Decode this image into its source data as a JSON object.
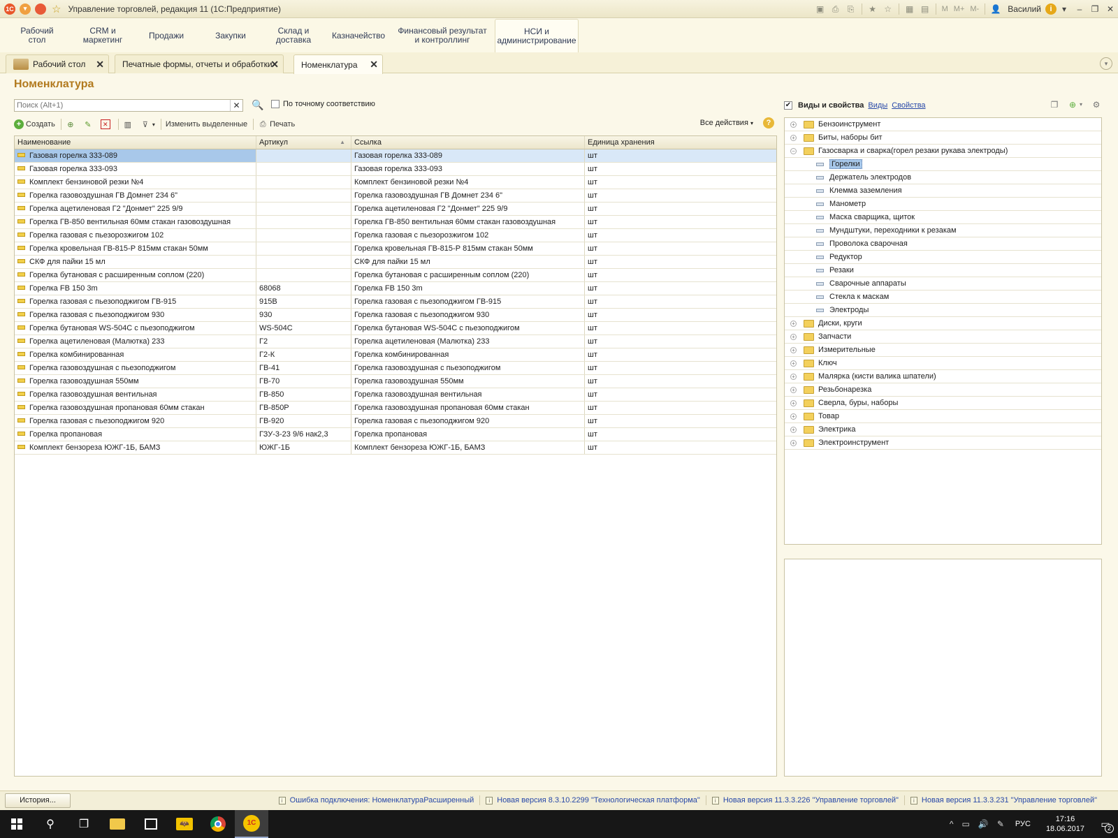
{
  "window": {
    "title": "Управление торговлей, редакция 11  (1С:Предприятие)",
    "user": "Василий",
    "m_buttons": [
      "M",
      "M+",
      "M-"
    ]
  },
  "sections": [
    {
      "label": "Рабочий\nстол"
    },
    {
      "label": "CRM и\nмаркетинг"
    },
    {
      "label": "Продажи"
    },
    {
      "label": "Закупки"
    },
    {
      "label": "Склад и\nдоставка"
    },
    {
      "label": "Казначейство"
    },
    {
      "label": "Финансовый результат\nи контроллинг"
    },
    {
      "label": "НСИ и\nадминистрирование",
      "active": true
    }
  ],
  "open_tabs": [
    {
      "label": "Рабочий стол"
    },
    {
      "label": "Печатные формы, отчеты и обработки"
    },
    {
      "label": "Номенклатура",
      "active": true
    }
  ],
  "page": {
    "title": "Номенклатура",
    "search_placeholder": "Поиск (Alt+1)",
    "exact_match_label": "По точному соответствию"
  },
  "toolbar": {
    "create": "Создать",
    "change_selected": "Изменить выделенные",
    "print": "Печать",
    "all_actions": "Все действия"
  },
  "table": {
    "columns": [
      "Наименование",
      "Артикул",
      "Ссылка",
      "Единица хранения"
    ],
    "rows": [
      [
        "Газовая горелка 333-089",
        "",
        "Газовая горелка 333-089",
        "шт"
      ],
      [
        "Газовая горелка 333-093",
        "",
        "Газовая горелка 333-093",
        "шт"
      ],
      [
        "Комплект  бензиновой резки №4",
        "",
        "Комплект  бензиновой резки №4",
        "шт"
      ],
      [
        "Горелка газовоздушная ГВ Домнет 234 6\"",
        "",
        "Горелка газовоздушная ГВ Домнет 234 6\"",
        "шт"
      ],
      [
        "Горелка ацетиленовая Г2 \"Донмет\" 225 9/9",
        "",
        "Горелка ацетиленовая Г2 \"Донмет\" 225 9/9",
        "шт"
      ],
      [
        "Горелка ГВ-850 вентильная 60мм стакан газовоздушная",
        "",
        "Горелка ГВ-850 вентильная 60мм стакан газовоздушная",
        "шт"
      ],
      [
        "Горелка газовая с пьезорозжигом 102",
        "",
        "Горелка газовая с пьезорозжигом 102",
        "шт"
      ],
      [
        "Горелка кровельная ГВ-815-Р 815мм стакан 50мм",
        "",
        "Горелка кровельная ГВ-815-Р 815мм стакан 50мм",
        "шт"
      ],
      [
        "СКФ для пайки 15 мл",
        "",
        "СКФ для пайки 15 мл",
        "шт"
      ],
      [
        "Горелка бутановая с расширенным соплом (220)",
        "",
        "Горелка бутановая с расширенным соплом (220)",
        "шт"
      ],
      [
        "Горелка FB 150 3m",
        "68068",
        "Горелка FB 150 3m",
        "шт"
      ],
      [
        "Горелка газовая с пьезоподжигом ГВ-915",
        "915В",
        "Горелка газовая с пьезоподжигом ГВ-915",
        "шт"
      ],
      [
        "Горелка газовая с пьезоподжигом 930",
        "930",
        "Горелка газовая с пьезоподжигом 930",
        "шт"
      ],
      [
        "Горелка бутановая WS-504C с пьезоподжигом",
        "WS-504C",
        "Горелка бутановая WS-504C с пьезоподжигом",
        "шт"
      ],
      [
        "Горелка ацетиленовая (Малютка) 233",
        "Г2",
        "Горелка ацетиленовая (Малютка) 233",
        "шт"
      ],
      [
        "Горелка комбинированная",
        "Г2-К",
        "Горелка комбинированная",
        "шт"
      ],
      [
        "Горелка газовоздушная с пьезоподжигом",
        "ГВ-41",
        "Горелка газовоздушная с пьезоподжигом",
        "шт"
      ],
      [
        "Горелка газовоздушная 550мм",
        "ГВ-70",
        "Горелка газовоздушная 550мм",
        "шт"
      ],
      [
        "Горелка газовоздушная вентильная",
        "ГВ-850",
        "Горелка газовоздушная вентильная",
        "шт"
      ],
      [
        "Горелка газовоздушная пропановая 60мм стакан",
        "ГВ-850Р",
        "Горелка газовоздушная пропановая 60мм стакан",
        "шт"
      ],
      [
        "Горелка газовая с пьезоподжигом 920",
        "ГВ-920",
        "Горелка газовая с пьезоподжигом 920",
        "шт"
      ],
      [
        "Горелка пропановая",
        "ГЗУ-3-23 9/6 нак2,3",
        "Горелка пропановая",
        "шт"
      ],
      [
        "Комплект  бензореза ЮЖГ-1Б, БАМЗ",
        "ЮЖГ-1Б",
        "Комплект  бензореза ЮЖГ-1Б, БАМЗ",
        "шт"
      ]
    ]
  },
  "kinds_panel": {
    "title": "Виды и свойства",
    "link_kinds": "Виды",
    "link_props": "Свойства",
    "tree": [
      {
        "label": "Бензоинструмент",
        "type": "folder",
        "tog": "+"
      },
      {
        "label": "Биты, наборы бит",
        "type": "folder",
        "tog": "+"
      },
      {
        "label": "Газосварка и сварка(горел резаки рукава электроды)",
        "type": "folder",
        "tog": "−"
      },
      {
        "label": "Горелки",
        "type": "leaf",
        "selected": true
      },
      {
        "label": "Держатель электродов",
        "type": "leaf"
      },
      {
        "label": "Клемма заземления",
        "type": "leaf"
      },
      {
        "label": "Манометр",
        "type": "leaf"
      },
      {
        "label": "Маска сварщика, щиток",
        "type": "leaf"
      },
      {
        "label": "Мундштуки, переходники к резакам",
        "type": "leaf"
      },
      {
        "label": "Проволока сварочная",
        "type": "leaf"
      },
      {
        "label": "Редуктор",
        "type": "leaf"
      },
      {
        "label": "Резаки",
        "type": "leaf"
      },
      {
        "label": "Сварочные аппараты",
        "type": "leaf"
      },
      {
        "label": "Стекла к маскам",
        "type": "leaf"
      },
      {
        "label": "Электроды",
        "type": "leaf"
      },
      {
        "label": "Диски, круги",
        "type": "folder",
        "tog": "+"
      },
      {
        "label": "Запчасти",
        "type": "folder",
        "tog": "+"
      },
      {
        "label": "Измерительные",
        "type": "folder",
        "tog": "+"
      },
      {
        "label": "Ключ",
        "type": "folder",
        "tog": "+"
      },
      {
        "label": "Малярка (кисти валика шпатели)",
        "type": "folder",
        "tog": "+"
      },
      {
        "label": "Резьбонарезка",
        "type": "folder",
        "tog": "+"
      },
      {
        "label": "Сверла, буры, наборы",
        "type": "folder",
        "tog": "+"
      },
      {
        "label": "Товар",
        "type": "folder",
        "tog": "+"
      },
      {
        "label": "Электрика",
        "type": "folder",
        "tog": "+"
      },
      {
        "label": "Электроинструмент",
        "type": "folder",
        "tog": "+"
      }
    ]
  },
  "statusbar": {
    "history": "История...",
    "notes": [
      "Ошибка подключения: НоменклатураРасширенный",
      "Новая версия 8.3.10.2299 \"Технологическая платформа\"",
      "Новая версия 11.3.3.226 \"Управление торговлей\"",
      "Новая версия 11.3.3.231 \"Управление торговлей\""
    ]
  },
  "taskbar": {
    "lang": "РУС",
    "time": "17:16",
    "date": "18.06.2017",
    "notifications": "2"
  }
}
